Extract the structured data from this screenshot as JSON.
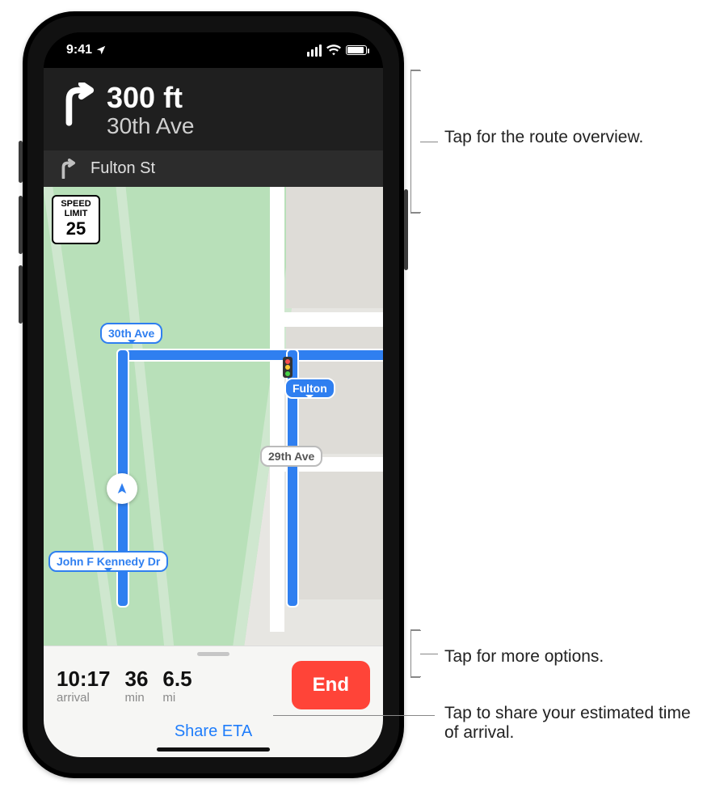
{
  "statusbar": {
    "time": "9:41"
  },
  "direction": {
    "primary_distance": "300 ft",
    "primary_street": "30th Ave",
    "secondary_street": "Fulton St"
  },
  "speed_limit": {
    "line1": "SPEED",
    "line2": "LIMIT",
    "value": "25"
  },
  "map_labels": {
    "thirtieth": "30th Ave",
    "fulton": "Fulton",
    "twentyninth": "29th Ave",
    "jfk": "John F Kennedy Dr"
  },
  "eta": {
    "arrival_value": "10:17",
    "arrival_label": "arrival",
    "duration_value": "36",
    "duration_label": "min",
    "distance_value": "6.5",
    "distance_label": "mi",
    "end_label": "End",
    "share_label": "Share ETA"
  },
  "callouts": {
    "route_overview": "Tap for the route overview.",
    "more_options": "Tap for more options.",
    "share_eta": "Tap to share your estimated time of arrival."
  }
}
